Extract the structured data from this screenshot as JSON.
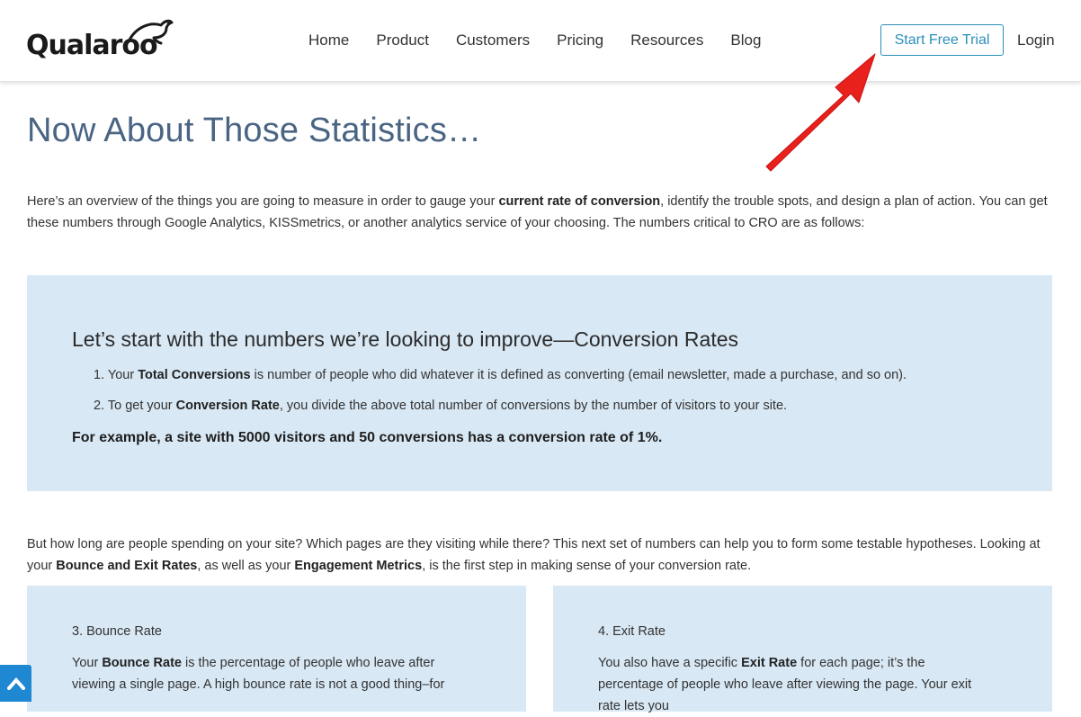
{
  "header": {
    "logo": "Qualaroo",
    "nav": [
      "Home",
      "Product",
      "Customers",
      "Pricing",
      "Resources",
      "Blog"
    ],
    "trial_button": "Start Free Trial",
    "login": "Login"
  },
  "page": {
    "title": "Now About Those Statistics…",
    "intro": {
      "p1": "Here’s an overview of the things you are going to measure in order to gauge your ",
      "b1": "current rate of conversion",
      "p2": ", identify the trouble spots, and design a plan of action. You can get these numbers through Google Analytics, KISSmetrics, or another analytics service of your choosing. The numbers critical to CRO are as follows:"
    },
    "conversion_box": {
      "heading": "Let’s start with the numbers we’re looking to improve—Conversion Rates",
      "item1": {
        "prefix": "1. Your ",
        "bold": "Total Conversions",
        "rest": " is number of people who did whatever it is defined as converting (email newsletter, made a purchase, and so on)."
      },
      "item2": {
        "prefix": "2. To get your ",
        "bold": "Conversion Rate",
        "rest": ", you divide the above total number of conversions by the number of visitors to your site."
      },
      "example": "For example, a site with 5000 visitors and 50 conversions has a conversion rate of 1%."
    },
    "para2": {
      "p1": "But how long are people spending on your site? Which pages are they visiting while there? This next set of numbers can help you to form some testable hypotheses. Looking at your ",
      "b1": "Bounce and Exit Rates",
      "p2": ", as well as your ",
      "b2": "Engagement Metrics",
      "p3": ", is the first step in making sense of your conversion rate."
    },
    "bounce_card": {
      "title": "3. Bounce Rate",
      "prefix": "Your ",
      "bold": "Bounce Rate",
      "rest": " is the percentage of people who leave after viewing a single page. A high bounce rate is not a good thing–for"
    },
    "exit_card": {
      "title": "4. Exit Rate",
      "prefix": "You also have a specific ",
      "bold": "Exit Rate",
      "rest": " for each page; it’s the percentage of people who leave after viewing the page. Your exit rate lets you"
    }
  },
  "colors": {
    "accent": "#2a8fb8",
    "title": "#4a6583",
    "box_bg": "#d8e8f4",
    "arrow": "#e8211d",
    "scroll_button": "#1e88d2"
  },
  "icons": [
    "kangaroo-logo-icon",
    "red-arrow-annotation",
    "chevron-up-icon"
  ]
}
